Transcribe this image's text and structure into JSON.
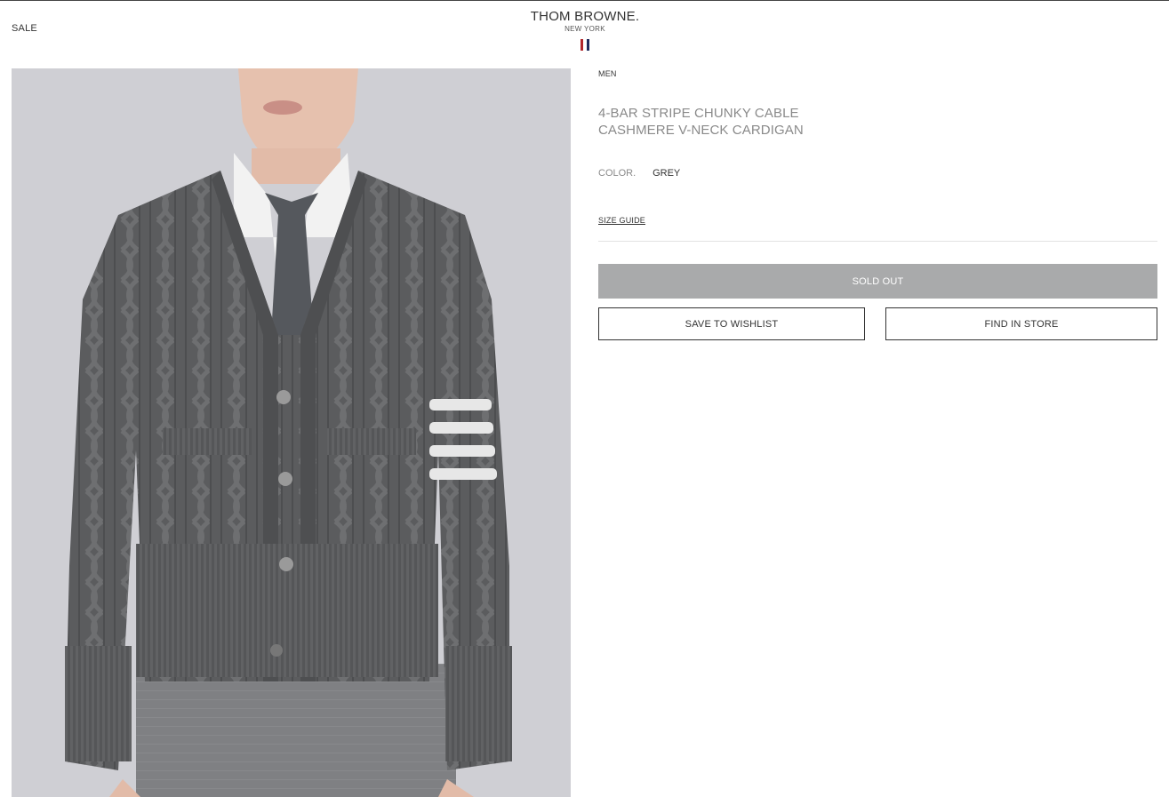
{
  "header": {
    "sale_label": "SALE",
    "brand_name": "THOM BROWNE.",
    "brand_location": "NEW YORK",
    "flag_colors": [
      "#b0262b",
      "#ffffff",
      "#1d2a5c"
    ]
  },
  "product": {
    "breadcrumb": "MEN",
    "title_line1": "4-BAR STRIPE CHUNKY CABLE",
    "title_line2": "CASHMERE V-NECK CARDIGAN",
    "color_label": "COLOR.",
    "color_value": "GREY",
    "size_guide_label": "SIZE GUIDE",
    "image_background": "#cfcfd4"
  },
  "actions": {
    "sold_out_label": "SOLD OUT",
    "wishlist_label": "SAVE TO WISHLIST",
    "find_store_label": "FIND IN STORE"
  }
}
